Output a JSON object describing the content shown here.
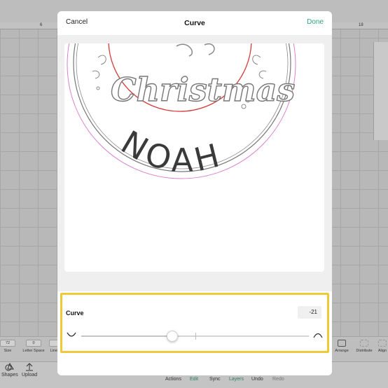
{
  "dialog": {
    "title": "Curve",
    "cancel_label": "Cancel",
    "done_label": "Done",
    "done_color": "#2aa57a"
  },
  "preview": {
    "top_text": "Christmas",
    "name_text": "NOAH"
  },
  "curve": {
    "label": "Curve",
    "value": "-21",
    "slider_position": 0.4,
    "highlight_color": "#f0c93a",
    "left_icon": "curve-down-icon",
    "right_icon": "curve-up-icon"
  },
  "background": {
    "ruler": [
      "6",
      "18"
    ],
    "tools": [
      {
        "value": "72",
        "label": "Size"
      },
      {
        "value": "0",
        "label": "Letter Space"
      },
      {
        "value": "",
        "label": "Line"
      }
    ],
    "right_tools": [
      "Arrange",
      "Distribute",
      "Align"
    ],
    "side_items": [
      "Shapes",
      "Upload"
    ],
    "bottom_items": [
      "Actions",
      "Edit",
      "Sync",
      "Layers",
      "Undo",
      "Redo"
    ]
  }
}
